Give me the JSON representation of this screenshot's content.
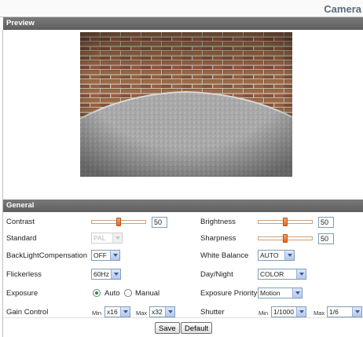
{
  "page": {
    "title": "Camera"
  },
  "preview": {
    "header": "Preview"
  },
  "general": {
    "header": "General",
    "contrast": {
      "label": "Contrast",
      "value": "50",
      "level": 0.5
    },
    "brightness": {
      "label": "Brightness",
      "value": "50",
      "level": 0.5
    },
    "standard": {
      "label": "Standard",
      "selected": "PAL"
    },
    "sharpness": {
      "label": "Sharpness",
      "value": "50",
      "level": 0.5
    },
    "backlight": {
      "label": "BackLightCompensation",
      "selected": "OFF"
    },
    "white_balance": {
      "label": "White Balance",
      "selected": "AUTO"
    },
    "flickerless": {
      "label": "Flickerless",
      "selected": "60Hz"
    },
    "day_night": {
      "label": "Day/Night",
      "selected": "COLOR"
    },
    "exposure": {
      "label": "Exposure",
      "options": [
        "Auto",
        "Manual"
      ],
      "selected": "Auto"
    },
    "exposure_priority": {
      "label": "Exposure Priority",
      "selected": "Motion"
    },
    "gain_control": {
      "label": "Gain Control",
      "min_label": "Min",
      "min": "x16",
      "max_label": "Max",
      "max": "x32"
    },
    "shutter": {
      "label": "Shutter",
      "min_label": "Min",
      "min": "1/1000",
      "max_label": "Max",
      "max": "1/6"
    }
  },
  "buttons": {
    "save": "Save",
    "default": "Default"
  },
  "colors": {
    "header_bg": "#666666",
    "slider_thumb": "#e2691f",
    "title": "#5a6a7a"
  }
}
